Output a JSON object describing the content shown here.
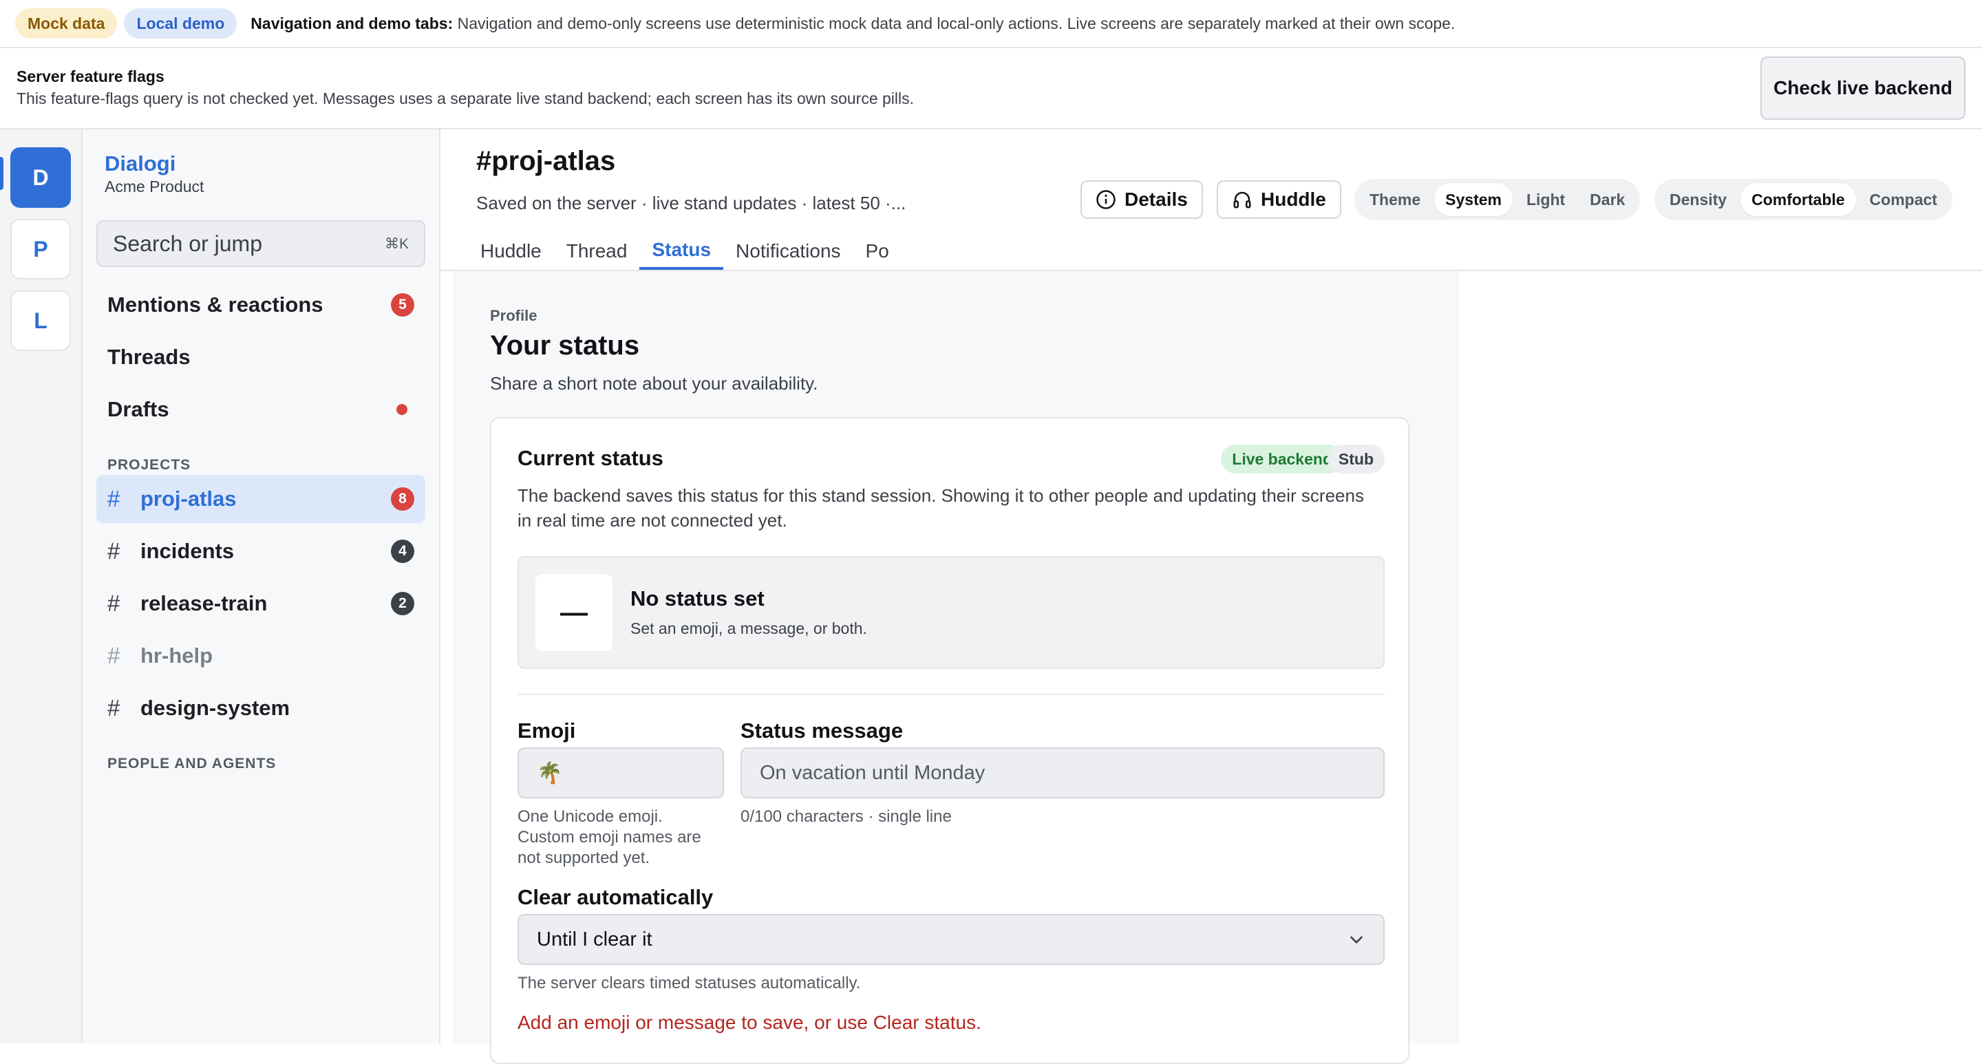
{
  "banner": {
    "mock_pill": "Mock data",
    "local_pill": "Local demo",
    "heading": "Navigation and demo tabs:",
    "text": "Navigation and demo-only screens use deterministic mock data and local-only actions. Live screens are separately marked at their own scope."
  },
  "flags": {
    "title": "Server feature flags",
    "description": "This feature-flags query is not checked yet. Messages uses a separate live stand backend; each screen has its own source pills.",
    "check_button": "Check live backend"
  },
  "workspaces": [
    {
      "letter": "D",
      "active": true
    },
    {
      "letter": "P",
      "active": false
    },
    {
      "letter": "L",
      "active": false
    }
  ],
  "sidebar": {
    "org_name": "Dialogi",
    "org_sub": "Acme Product",
    "search_placeholder": "Search or jump",
    "search_shortcut": "⌘K",
    "items": [
      {
        "label": "Mentions & reactions",
        "badge": "5"
      },
      {
        "label": "Threads"
      },
      {
        "label": "Drafts"
      }
    ],
    "projects_heading": "PROJECTS",
    "channels": [
      {
        "label": "proj-atlas",
        "badge": "8"
      },
      {
        "label": "incidents",
        "badge": "4"
      },
      {
        "label": "release-train",
        "badge": "2"
      },
      {
        "label": "hr-help"
      },
      {
        "label": "design-system"
      }
    ],
    "people_heading": "PEOPLE AND AGENTS"
  },
  "header": {
    "channel": "#proj-atlas",
    "subtitle": "Saved on the server · live stand updates · latest 50 ·...",
    "details_button": "Details",
    "huddle_button": "Huddle",
    "theme": {
      "label": "Theme",
      "options": [
        "System",
        "Light",
        "Dark"
      ],
      "selected": "System"
    },
    "density": {
      "label": "Density",
      "options": [
        "Comfortable",
        "Compact"
      ],
      "selected": "Comfortable"
    },
    "tabs": [
      "Huddle",
      "Thread",
      "Status",
      "Notifications",
      "Po"
    ],
    "active_tab": "Status"
  },
  "status": {
    "eyebrow": "Profile",
    "title": "Your status",
    "description": "Share a short note about your availability.",
    "card": {
      "title": "Current status",
      "live_pill": "Live backend",
      "stub_pill": "Stub",
      "description": "The backend saves this status for this stand session. Showing it to other people and updating their screens in real time are not connected yet.",
      "preview_emoji": "—",
      "preview_title": "No status set",
      "preview_sub": "Set an emoji, a message, or both.",
      "emoji_label": "Emoji",
      "emoji_value": "🌴",
      "emoji_hint": "One Unicode emoji. Custom emoji names are not supported yet.",
      "message_label": "Status message",
      "message_placeholder": "On vacation until Monday",
      "message_hint": "0/100 characters · single line",
      "clear_label": "Clear automatically",
      "clear_value": "Until I clear it",
      "clear_hint": "The server clears timed statuses automatically.",
      "error": "Add an emoji or message to save, or use Clear status."
    }
  },
  "colors": {
    "accent": "#2f6fd6",
    "badge_red": "#d9443f",
    "live_green": "#1e7a34",
    "error_red": "#b3261e"
  }
}
